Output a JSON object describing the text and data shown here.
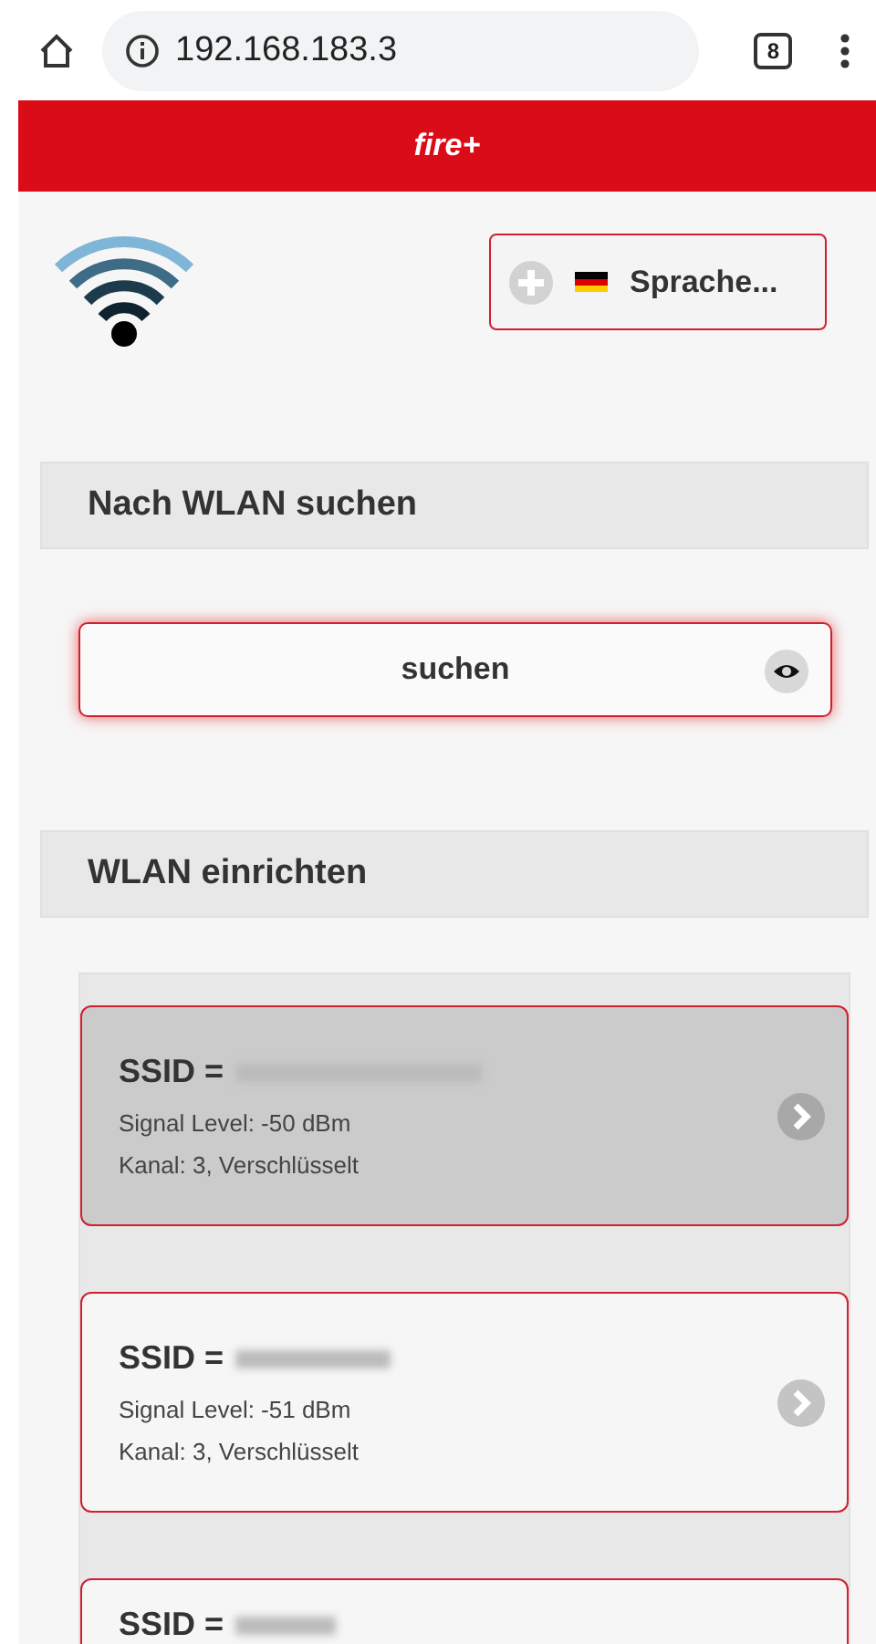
{
  "browser": {
    "url": "192.168.183.3",
    "tab_count": "8"
  },
  "header": {
    "title": "fire+"
  },
  "language_button": {
    "label": "Sprache..."
  },
  "sections": [
    {
      "title": "Nach WLAN suchen"
    },
    {
      "title": "WLAN einrichten"
    }
  ],
  "search_button": {
    "label": "suchen"
  },
  "networks": [
    {
      "ssid_label": "SSID =",
      "signal": "Signal Level: -50 dBm",
      "details": "Kanal: 3, Verschlüsselt",
      "selected": true
    },
    {
      "ssid_label": "SSID =",
      "signal": "Signal Level: -51 dBm",
      "details": "Kanal: 3, Verschlüsselt",
      "selected": false
    },
    {
      "ssid_label": "SSID =",
      "selected": false
    }
  ]
}
